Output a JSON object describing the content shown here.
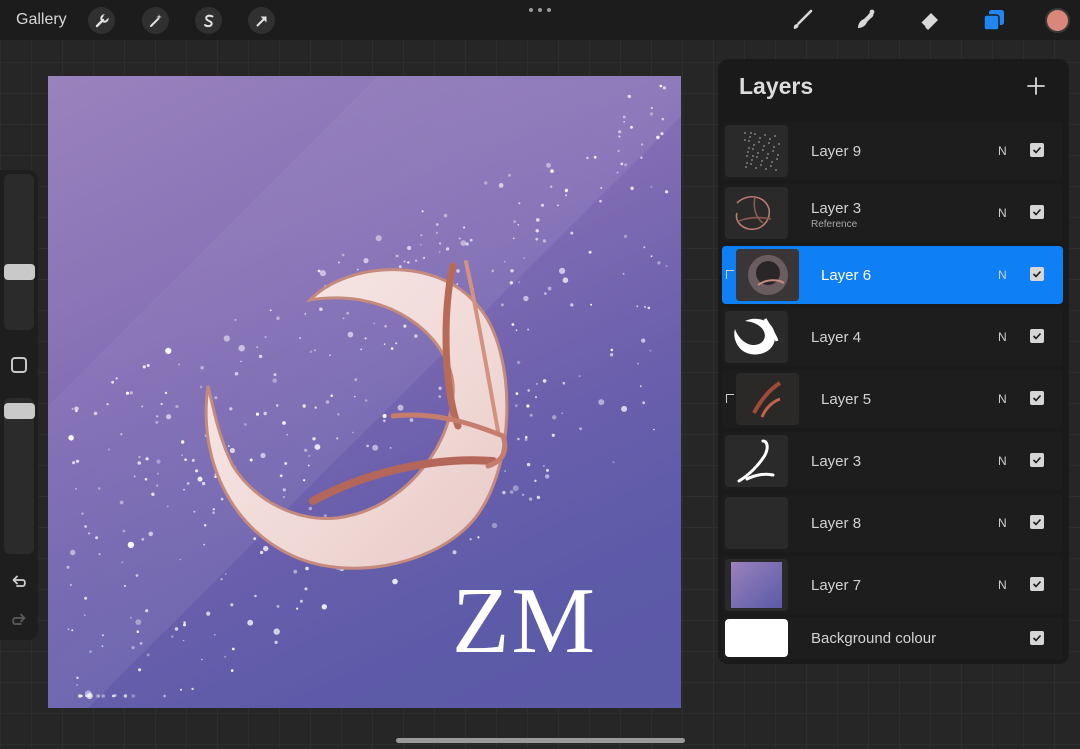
{
  "toolbar": {
    "gallery_label": "Gallery",
    "left_tools": [
      "wrench-icon",
      "magic-wand-icon",
      "selection-s-icon",
      "transform-arrow-icon"
    ],
    "right_tools": [
      "brush-icon",
      "smudge-icon",
      "eraser-icon",
      "layers-icon"
    ],
    "layers_accent_color": "#1f86f2",
    "current_color": "#d8877a"
  },
  "canvas": {
    "overlay_text": "ZM",
    "background_colors": [
      "#9a82bd",
      "#5a5aa6"
    ]
  },
  "layers_panel": {
    "title": "Layers",
    "layers": [
      {
        "name": "Layer 9",
        "sub": "",
        "blend": "N",
        "visible": true,
        "selected": false,
        "clipped": false,
        "thumb": "sparkles"
      },
      {
        "name": "Layer 3",
        "sub": "Reference",
        "blend": "N",
        "visible": true,
        "selected": false,
        "clipped": false,
        "thumb": "ring-outline"
      },
      {
        "name": "Layer 6",
        "sub": "",
        "blend": "N",
        "visible": true,
        "selected": true,
        "clipped": true,
        "thumb": "moon-shade"
      },
      {
        "name": "Layer 4",
        "sub": "",
        "blend": "N",
        "visible": true,
        "selected": false,
        "clipped": false,
        "thumb": "white-moon"
      },
      {
        "name": "Layer 5",
        "sub": "",
        "blend": "N",
        "visible": true,
        "selected": false,
        "clipped": true,
        "thumb": "copper-stroke"
      },
      {
        "name": "Layer 3",
        "sub": "",
        "blend": "N",
        "visible": true,
        "selected": false,
        "clipped": false,
        "thumb": "white-stroke"
      },
      {
        "name": "Layer 8",
        "sub": "",
        "blend": "N",
        "visible": true,
        "selected": false,
        "clipped": false,
        "thumb": "dark"
      },
      {
        "name": "Layer 7",
        "sub": "",
        "blend": "N",
        "visible": true,
        "selected": false,
        "clipped": false,
        "thumb": "purple-gradient"
      }
    ],
    "background": {
      "name": "Background colour",
      "visible": true,
      "color": "#ffffff"
    }
  }
}
